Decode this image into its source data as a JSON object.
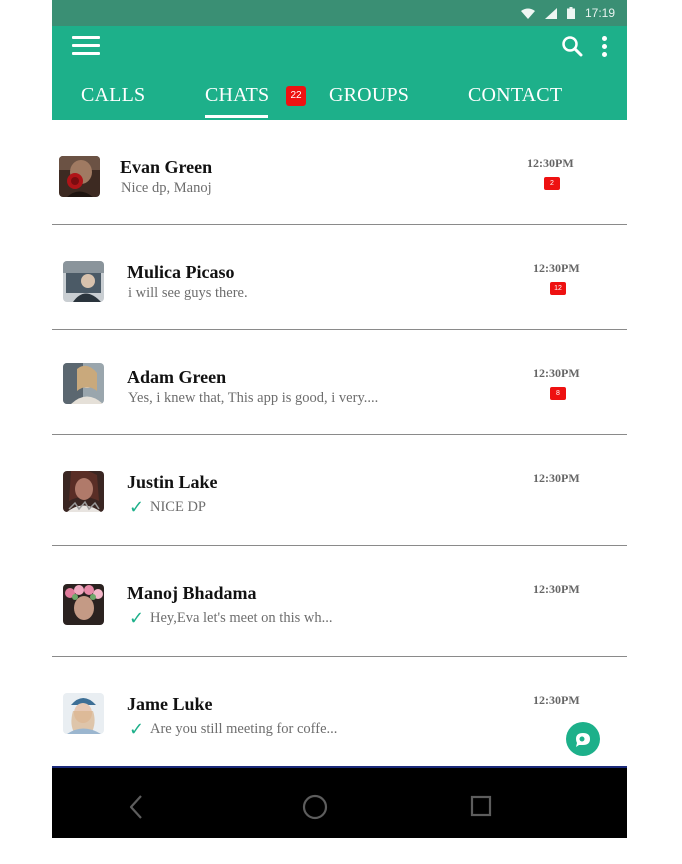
{
  "status_bar": {
    "time": "17:19",
    "icons": [
      "wifi-icon",
      "signal-icon",
      "battery-icon"
    ]
  },
  "app_bar": {
    "icons": [
      "menu-icon",
      "search-icon",
      "more-vert-icon"
    ],
    "tabs": [
      {
        "label": "CALLS"
      },
      {
        "label": "CHATS",
        "selected": true,
        "badge": "22"
      },
      {
        "label": "GROUPS"
      },
      {
        "label": "CONTACT"
      }
    ]
  },
  "chats": [
    {
      "name": "Evan Green",
      "message": "Nice dp, Manoj",
      "time": "12:30PM",
      "unread": "2",
      "read": false
    },
    {
      "name": "Mulica Picaso",
      "message": "i will see guys there.",
      "time": "12:30PM",
      "unread": "12",
      "read": false
    },
    {
      "name": "Adam Green",
      "message": "Yes, i knew that, This app is good, i very....",
      "time": "12:30PM",
      "unread": "8",
      "read": false
    },
    {
      "name": "Justin Lake",
      "message": "NICE DP",
      "time": "12:30PM",
      "unread": "",
      "read": true
    },
    {
      "name": "Manoj Bhadama",
      "message": "Hey,Eva let's meet on this wh...",
      "time": "12:30PM",
      "unread": "",
      "read": true
    },
    {
      "name": "Jame Luke",
      "message": "Are you still meeting for coffe...",
      "time": "12:30PM",
      "unread": "",
      "read": true
    }
  ],
  "fab": {
    "icon": "new-chat-icon"
  },
  "nav_bar": {
    "icons": [
      "back-icon",
      "home-icon",
      "recents-icon"
    ]
  },
  "colors": {
    "primary": "#1db08a",
    "status_bar": "#3a8f74",
    "badge": "#ee1111",
    "nav_bar": "#000000"
  }
}
